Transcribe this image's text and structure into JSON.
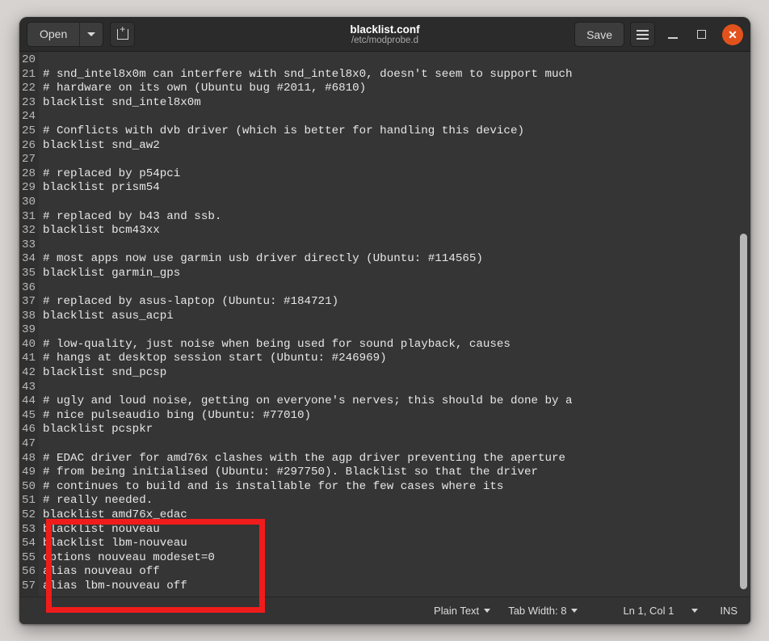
{
  "window": {
    "title": "blacklist.conf",
    "subtitle": "/etc/modprobe.d"
  },
  "toolbar": {
    "open_label": "Open",
    "open_dropdown_icon": "chevron-down-icon",
    "new_tab_icon": "new-document-icon",
    "save_label": "Save",
    "menu_icon": "hamburger-menu-icon",
    "minimize_icon": "minimize-icon",
    "maximize_icon": "maximize-icon",
    "close_icon": "close-icon",
    "close_color": "#e2521c"
  },
  "editor": {
    "first_visible_line": 20,
    "lines": [
      {
        "num": "20",
        "text": ""
      },
      {
        "num": "21",
        "text": "# snd_intel8x0m can interfere with snd_intel8x0, doesn't seem to support much"
      },
      {
        "num": "22",
        "text": "# hardware on its own (Ubuntu bug #2011, #6810)"
      },
      {
        "num": "23",
        "text": "blacklist snd_intel8x0m"
      },
      {
        "num": "24",
        "text": ""
      },
      {
        "num": "25",
        "text": "# Conflicts with dvb driver (which is better for handling this device)"
      },
      {
        "num": "26",
        "text": "blacklist snd_aw2"
      },
      {
        "num": "27",
        "text": ""
      },
      {
        "num": "28",
        "text": "# replaced by p54pci"
      },
      {
        "num": "29",
        "text": "blacklist prism54"
      },
      {
        "num": "30",
        "text": ""
      },
      {
        "num": "31",
        "text": "# replaced by b43 and ssb."
      },
      {
        "num": "32",
        "text": "blacklist bcm43xx"
      },
      {
        "num": "33",
        "text": ""
      },
      {
        "num": "34",
        "text": "# most apps now use garmin usb driver directly (Ubuntu: #114565)"
      },
      {
        "num": "35",
        "text": "blacklist garmin_gps"
      },
      {
        "num": "36",
        "text": ""
      },
      {
        "num": "37",
        "text": "# replaced by asus-laptop (Ubuntu: #184721)"
      },
      {
        "num": "38",
        "text": "blacklist asus_acpi"
      },
      {
        "num": "39",
        "text": ""
      },
      {
        "num": "40",
        "text": "# low-quality, just noise when being used for sound playback, causes"
      },
      {
        "num": "41",
        "text": "# hangs at desktop session start (Ubuntu: #246969)"
      },
      {
        "num": "42",
        "text": "blacklist snd_pcsp"
      },
      {
        "num": "43",
        "text": ""
      },
      {
        "num": "44",
        "text": "# ugly and loud noise, getting on everyone's nerves; this should be done by a"
      },
      {
        "num": "45",
        "text": "# nice pulseaudio bing (Ubuntu: #77010)"
      },
      {
        "num": "46",
        "text": "blacklist pcspkr"
      },
      {
        "num": "47",
        "text": ""
      },
      {
        "num": "48",
        "text": "# EDAC driver for amd76x clashes with the agp driver preventing the aperture"
      },
      {
        "num": "49",
        "text": "# from being initialised (Ubuntu: #297750). Blacklist so that the driver"
      },
      {
        "num": "50",
        "text": "# continues to build and is installable for the few cases where its"
      },
      {
        "num": "51",
        "text": "# really needed."
      },
      {
        "num": "52",
        "text": "blacklist amd76x_edac"
      },
      {
        "num": "53",
        "text": "blacklist nouveau"
      },
      {
        "num": "54",
        "text": "blacklist lbm-nouveau"
      },
      {
        "num": "55",
        "text": "options nouveau modeset=0"
      },
      {
        "num": "56",
        "text": "alias nouveau off"
      },
      {
        "num": "57",
        "text": "alias lbm-nouveau off"
      }
    ]
  },
  "statusbar": {
    "language": "Plain Text",
    "tab_width": "Tab Width: 8",
    "position": "Ln 1, Col 1",
    "insert_mode": "INS"
  },
  "annotation": {
    "color": "#f01c1c",
    "highlights_lines": [
      "52",
      "53",
      "54",
      "55",
      "56",
      "57"
    ]
  }
}
